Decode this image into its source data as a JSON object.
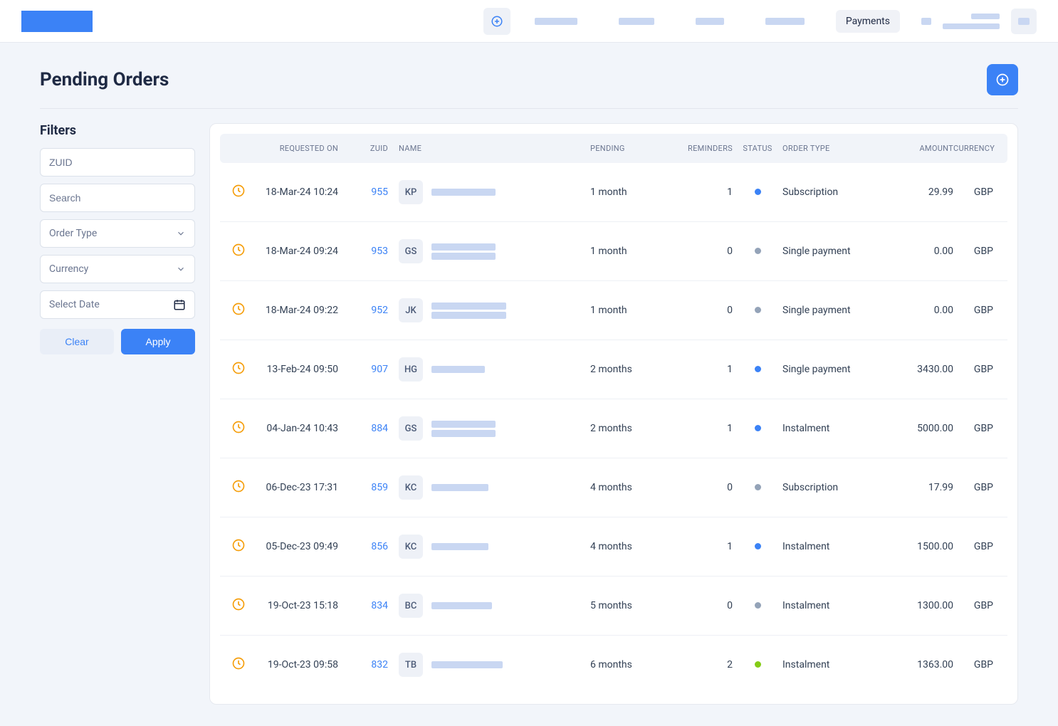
{
  "header": {
    "nav_active_label": "Payments"
  },
  "page": {
    "title": "Pending Orders"
  },
  "filters": {
    "title": "Filters",
    "zuid_placeholder": "ZUID",
    "search_placeholder": "Search",
    "order_type_label": "Order Type",
    "currency_label": "Currency",
    "date_label": "Select Date",
    "clear_label": "Clear",
    "apply_label": "Apply"
  },
  "table": {
    "columns": {
      "requested_on": "REQUESTED ON",
      "zuid": "ZUID",
      "name": "NAME",
      "pending": "PENDING",
      "reminders": "REMINDERS",
      "status": "STATUS",
      "order_type": "ORDER TYPE",
      "amount": "AMOUNT",
      "currency": "CURRENCY"
    },
    "rows": [
      {
        "date": "18-Mar-24 10:24",
        "zuid": "955",
        "initials": "KP",
        "name_bars": [
          90
        ],
        "pending": "1 month",
        "reminders": "1",
        "status_color": "#3b82f6",
        "order_type": "Subscription",
        "amount": "29.99",
        "currency": "GBP"
      },
      {
        "date": "18-Mar-24 09:24",
        "zuid": "953",
        "initials": "GS",
        "name_bars": [
          90,
          90
        ],
        "pending": "1 month",
        "reminders": "0",
        "status_color": "#94a3b8",
        "order_type": "Single payment",
        "amount": "0.00",
        "currency": "GBP"
      },
      {
        "date": "18-Mar-24 09:22",
        "zuid": "952",
        "initials": "JK",
        "name_bars": [
          105,
          105
        ],
        "pending": "1 month",
        "reminders": "0",
        "status_color": "#94a3b8",
        "order_type": "Single payment",
        "amount": "0.00",
        "currency": "GBP"
      },
      {
        "date": "13-Feb-24 09:50",
        "zuid": "907",
        "initials": "HG",
        "name_bars": [
          75
        ],
        "pending": "2 months",
        "reminders": "1",
        "status_color": "#3b82f6",
        "order_type": "Single payment",
        "amount": "3430.00",
        "currency": "GBP"
      },
      {
        "date": "04-Jan-24 10:43",
        "zuid": "884",
        "initials": "GS",
        "name_bars": [
          90,
          90
        ],
        "pending": "2 months",
        "reminders": "1",
        "status_color": "#3b82f6",
        "order_type": "Instalment",
        "amount": "5000.00",
        "currency": "GBP"
      },
      {
        "date": "06-Dec-23 17:31",
        "zuid": "859",
        "initials": "KC",
        "name_bars": [
          80
        ],
        "pending": "4 months",
        "reminders": "0",
        "status_color": "#94a3b8",
        "order_type": "Subscription",
        "amount": "17.99",
        "currency": "GBP"
      },
      {
        "date": "05-Dec-23 09:49",
        "zuid": "856",
        "initials": "KC",
        "name_bars": [
          80
        ],
        "pending": "4 months",
        "reminders": "1",
        "status_color": "#3b82f6",
        "order_type": "Instalment",
        "amount": "1500.00",
        "currency": "GBP"
      },
      {
        "date": "19-Oct-23 15:18",
        "zuid": "834",
        "initials": "BC",
        "name_bars": [
          85
        ],
        "pending": "5 months",
        "reminders": "0",
        "status_color": "#94a3b8",
        "order_type": "Instalment",
        "amount": "1300.00",
        "currency": "GBP"
      },
      {
        "date": "19-Oct-23 09:58",
        "zuid": "832",
        "initials": "TB",
        "name_bars": [
          100
        ],
        "pending": "6 months",
        "reminders": "2",
        "status_color": "#84cc16",
        "order_type": "Instalment",
        "amount": "1363.00",
        "currency": "GBP"
      }
    ]
  }
}
